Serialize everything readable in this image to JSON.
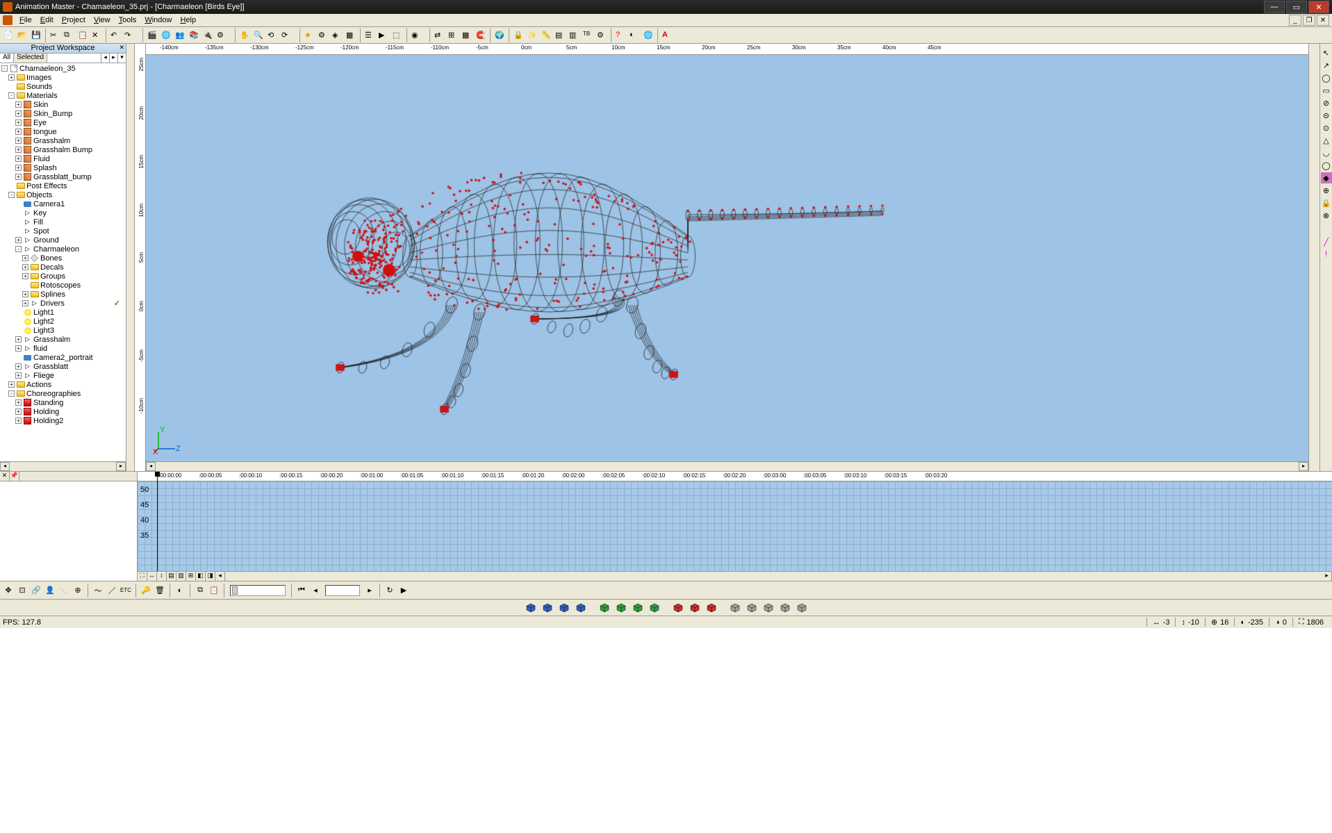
{
  "title": "Animation Master - Chamaeleon_35.prj - [Charmaeleon [Birds Eye]]",
  "menu": [
    "File",
    "Edit",
    "Project",
    "View",
    "Tools",
    "Window",
    "Help"
  ],
  "workspace_title": "Project Workspace",
  "workspace_tabs": [
    "All",
    "Selected"
  ],
  "tree": [
    {
      "d": 0,
      "e": "-",
      "i": "prj",
      "l": "Chamaeleon_35"
    },
    {
      "d": 1,
      "e": "+",
      "i": "folder",
      "l": "Images"
    },
    {
      "d": 1,
      "e": "",
      "i": "folder",
      "l": "Sounds"
    },
    {
      "d": 1,
      "e": "-",
      "i": "folder",
      "l": "Materials"
    },
    {
      "d": 2,
      "e": "+",
      "i": "mat",
      "l": "Skin"
    },
    {
      "d": 2,
      "e": "+",
      "i": "mat",
      "l": "Skin_Bump"
    },
    {
      "d": 2,
      "e": "+",
      "i": "mat",
      "l": "Eye"
    },
    {
      "d": 2,
      "e": "+",
      "i": "mat",
      "l": "tongue"
    },
    {
      "d": 2,
      "e": "+",
      "i": "mat",
      "l": "Grasshalm"
    },
    {
      "d": 2,
      "e": "+",
      "i": "mat",
      "l": "Grasshalm Bump"
    },
    {
      "d": 2,
      "e": "+",
      "i": "mat",
      "l": "Fluid"
    },
    {
      "d": 2,
      "e": "+",
      "i": "mat",
      "l": "Splash"
    },
    {
      "d": 2,
      "e": "+",
      "i": "mat",
      "l": "Grassblatt_bump"
    },
    {
      "d": 1,
      "e": "",
      "i": "folder",
      "l": "Post Effects"
    },
    {
      "d": 1,
      "e": "-",
      "i": "folder",
      "l": "Objects"
    },
    {
      "d": 2,
      "e": "",
      "i": "cam",
      "l": "Camera1"
    },
    {
      "d": 2,
      "e": "",
      "i": "obj",
      "l": "Key"
    },
    {
      "d": 2,
      "e": "",
      "i": "obj",
      "l": "Fill"
    },
    {
      "d": 2,
      "e": "",
      "i": "obj",
      "l": "Spot"
    },
    {
      "d": 2,
      "e": "+",
      "i": "obj",
      "l": "Ground"
    },
    {
      "d": 2,
      "e": "-",
      "i": "obj",
      "l": "Charmaeleon"
    },
    {
      "d": 3,
      "e": "+",
      "i": "bone",
      "l": "Bones"
    },
    {
      "d": 3,
      "e": "+",
      "i": "folder",
      "l": "Decals"
    },
    {
      "d": 3,
      "e": "+",
      "i": "folder",
      "l": "Groups"
    },
    {
      "d": 3,
      "e": "",
      "i": "folder",
      "l": "Rotoscopes"
    },
    {
      "d": 3,
      "e": "+",
      "i": "folder",
      "l": "Splines"
    },
    {
      "d": 3,
      "e": "+",
      "i": "obj",
      "l": "Drivers",
      "c": true
    },
    {
      "d": 2,
      "e": "",
      "i": "light",
      "l": "Light1"
    },
    {
      "d": 2,
      "e": "",
      "i": "light",
      "l": "Light2"
    },
    {
      "d": 2,
      "e": "",
      "i": "light",
      "l": "Light3"
    },
    {
      "d": 2,
      "e": "+",
      "i": "obj",
      "l": "Grasshalm"
    },
    {
      "d": 2,
      "e": "+",
      "i": "obj",
      "l": "fluid"
    },
    {
      "d": 2,
      "e": "",
      "i": "cam",
      "l": "Camera2_portrait"
    },
    {
      "d": 2,
      "e": "+",
      "i": "obj",
      "l": "Grassblatt"
    },
    {
      "d": 2,
      "e": "+",
      "i": "obj",
      "l": "Fliege"
    },
    {
      "d": 1,
      "e": "+",
      "i": "folder",
      "l": "Actions"
    },
    {
      "d": 1,
      "e": "-",
      "i": "folder",
      "l": "Choreographies"
    },
    {
      "d": 2,
      "e": "+",
      "i": "chor",
      "l": "Standing"
    },
    {
      "d": 2,
      "e": "+",
      "i": "chor",
      "l": "Holding"
    },
    {
      "d": 2,
      "e": "+",
      "i": "chor",
      "l": "Holding2"
    }
  ],
  "ruler_h": [
    "-140cm",
    "-135cm",
    "-130cm",
    "-125cm",
    "-120cm",
    "-115cm",
    "-110cm",
    "-5cm",
    "0cm",
    "5cm",
    "10cm",
    "15cm",
    "20cm",
    "25cm",
    "30cm",
    "35cm",
    "40cm",
    "45cm"
  ],
  "ruler_v": [
    "25cm",
    "20cm",
    "15cm",
    "10cm",
    "5cm",
    "0cm",
    "-5cm",
    "-10cm"
  ],
  "timeline_ticks": [
    ":00:00:00",
    ":00:00:05",
    ":00:00:10",
    ":00:00:15",
    ":00:00:20",
    ":00:01:00",
    ":00:01:05",
    ":00:01:10",
    ":00:01:15",
    ":00:01:20",
    ":00:02:00",
    ":00:02:05",
    ":00:02:10",
    ":00:02:15",
    ":00:02:20",
    ":00:03:00",
    ":00:03:05",
    ":00:03:10",
    ":00:03:15",
    ":00:03:20"
  ],
  "timeline_vlabels": [
    "50",
    "45",
    "40",
    "35"
  ],
  "etc_label": "ETC",
  "status_fps": "FPS: 127.8",
  "status_coords": [
    {
      "icon": "↔",
      "v": "-3"
    },
    {
      "icon": "↕",
      "v": "-10"
    },
    {
      "icon": "⊕",
      "v": "16"
    },
    {
      "icon": "◐",
      "v": "-235"
    },
    {
      "icon": "◑",
      "v": "0"
    },
    {
      "icon": "⛶",
      "v": "1806"
    }
  ],
  "mode_colors": [
    "#3060c0",
    "#3060c0",
    "#3060c0",
    "#3060c0",
    "#30a040",
    "#30a040",
    "#30a040",
    "#30a040",
    "#cc3030",
    "#cc3030",
    "#cc3030",
    "#a0a0a0",
    "#a0a0a0",
    "#a0a0a0",
    "#a0a0a0",
    "#a0a0a0"
  ]
}
